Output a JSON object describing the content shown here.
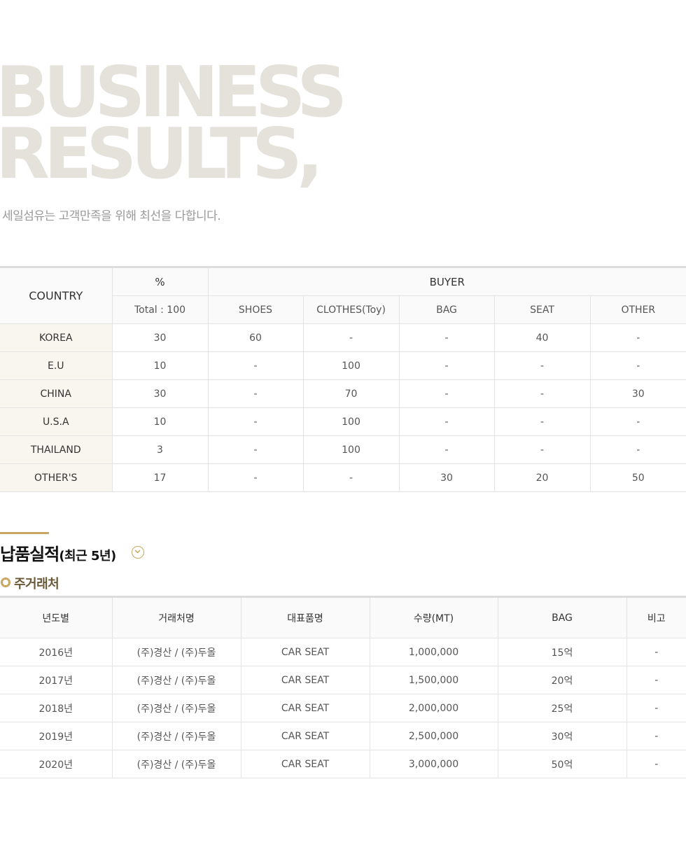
{
  "hero": {
    "title_line1": "BUSINESS",
    "title_line2": "RESULTS,",
    "subtitle": "세일섬유는 고객만족을 위해 최선을 다합니다."
  },
  "results_table": {
    "country_header": "COUNTRY",
    "percent_header": "%",
    "buyer_header": "BUYER",
    "total_label": "Total : 100",
    "buyer_columns": [
      "SHOES",
      "CLOTHES(Toy)",
      "BAG",
      "SEAT",
      "OTHER"
    ],
    "rows": [
      {
        "country": "KOREA",
        "percent": "30",
        "shoes": "60",
        "clothes": "-",
        "bag": "-",
        "seat": "40",
        "other": "-"
      },
      {
        "country": "E.U",
        "percent": "10",
        "shoes": "-",
        "clothes": "100",
        "bag": "-",
        "seat": "-",
        "other": "-"
      },
      {
        "country": "CHINA",
        "percent": "30",
        "shoes": "-",
        "clothes": "70",
        "bag": "-",
        "seat": "-",
        "other": "30"
      },
      {
        "country": "U.S.A",
        "percent": "10",
        "shoes": "-",
        "clothes": "100",
        "bag": "-",
        "seat": "-",
        "other": "-"
      },
      {
        "country": "THAILAND",
        "percent": "3",
        "shoes": "-",
        "clothes": "100",
        "bag": "-",
        "seat": "-",
        "other": "-"
      },
      {
        "country": "OTHER'S",
        "percent": "17",
        "shoes": "-",
        "clothes": "-",
        "bag": "30",
        "seat": "20",
        "other": "50"
      }
    ]
  },
  "delivery": {
    "title": "납품실적",
    "title_suffix": "(최근 5년)",
    "sub_heading": "주거래처",
    "columns": [
      "년도별",
      "거래처명",
      "대표품명",
      "수량(MT)",
      "BAG",
      "비고"
    ],
    "rows": [
      {
        "year": "2016년",
        "client": "(주)경산 / (주)두올",
        "product": "CAR SEAT",
        "quantity": "1,000,000",
        "bag": "15억",
        "note": "-"
      },
      {
        "year": "2017년",
        "client": "(주)경산 / (주)두올",
        "product": "CAR SEAT",
        "quantity": "1,500,000",
        "bag": "20억",
        "note": "-"
      },
      {
        "year": "2018년",
        "client": "(주)경산 / (주)두올",
        "product": "CAR SEAT",
        "quantity": "2,000,000",
        "bag": "25억",
        "note": "-"
      },
      {
        "year": "2019년",
        "client": "(주)경산 / (주)두올",
        "product": "CAR SEAT",
        "quantity": "2,500,000",
        "bag": "30억",
        "note": "-"
      },
      {
        "year": "2020년",
        "client": "(주)경산 / (주)두올",
        "product": "CAR SEAT",
        "quantity": "3,000,000",
        "bag": "50억",
        "note": "-"
      }
    ]
  },
  "colors": {
    "accent_gold": "#c7a762",
    "hero_text": "#e5e2dc",
    "country_cell_bg": "#f8f6ee"
  },
  "icons": {
    "toggle": "chevron-down-circle-icon",
    "bullet": "ring-bullet-icon"
  }
}
